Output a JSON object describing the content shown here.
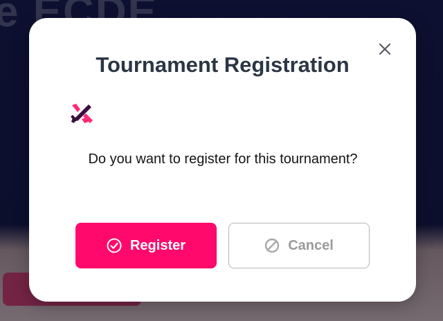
{
  "background": {
    "heading_text": "e ECDE"
  },
  "modal": {
    "title": "Tournament Registration",
    "message": "Do you want to register for this tournament?",
    "close_icon": "close-icon",
    "logo_icon": "crossed-swords-logo-icon",
    "buttons": {
      "register_label": "Register",
      "register_icon": "check-circle-icon",
      "cancel_label": "Cancel",
      "cancel_icon": "ban-circle-icon"
    }
  },
  "colors": {
    "accent": "#ff0a6c",
    "title": "#2b3645",
    "cancel_text": "#9a9a9a",
    "cancel_border": "#b5b5b5",
    "logo_dark": "#3a1040",
    "logo_pink": "#ff2a76"
  }
}
